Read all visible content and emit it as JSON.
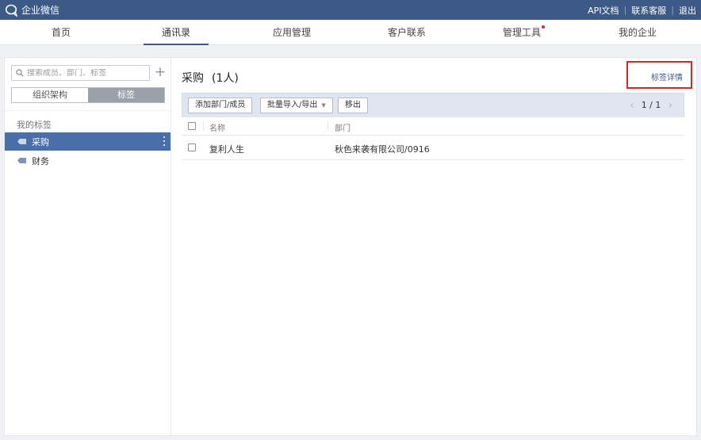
{
  "app": {
    "name": "企业微信",
    "links": [
      "API文档",
      "联系客服",
      "退出"
    ]
  },
  "nav": {
    "items": [
      "首页",
      "通讯录",
      "应用管理",
      "客户联系",
      "管理工具",
      "我的企业"
    ],
    "active": "通讯录",
    "badge_on": "管理工具"
  },
  "left": {
    "search_placeholder": "搜索成员、部门、标签",
    "add_symbol": "+",
    "tabs": [
      "组织架构",
      "标签"
    ],
    "active_tab": "标签",
    "section_title": "我的标签",
    "tags": [
      "采购",
      "财务"
    ],
    "selected_tag": "采购"
  },
  "right": {
    "title": "采购",
    "count": "(1人)",
    "tag_detail_link": "标签详情",
    "buttons": {
      "add": "添加部门/成员",
      "batch": "批量导入/导出",
      "remove": "移出"
    },
    "pager": "1 / 1",
    "columns": [
      "名称",
      "部门"
    ],
    "rows": [
      {
        "name": "复利人生",
        "dept": "秋色来袭有限公司/0916"
      }
    ]
  },
  "colors": {
    "topbar": "#3d5a86",
    "selected": "#4a6ea9",
    "toolbar": "#dfe6f0",
    "highlight_box": "#e02020",
    "badge": "#e0263b"
  }
}
